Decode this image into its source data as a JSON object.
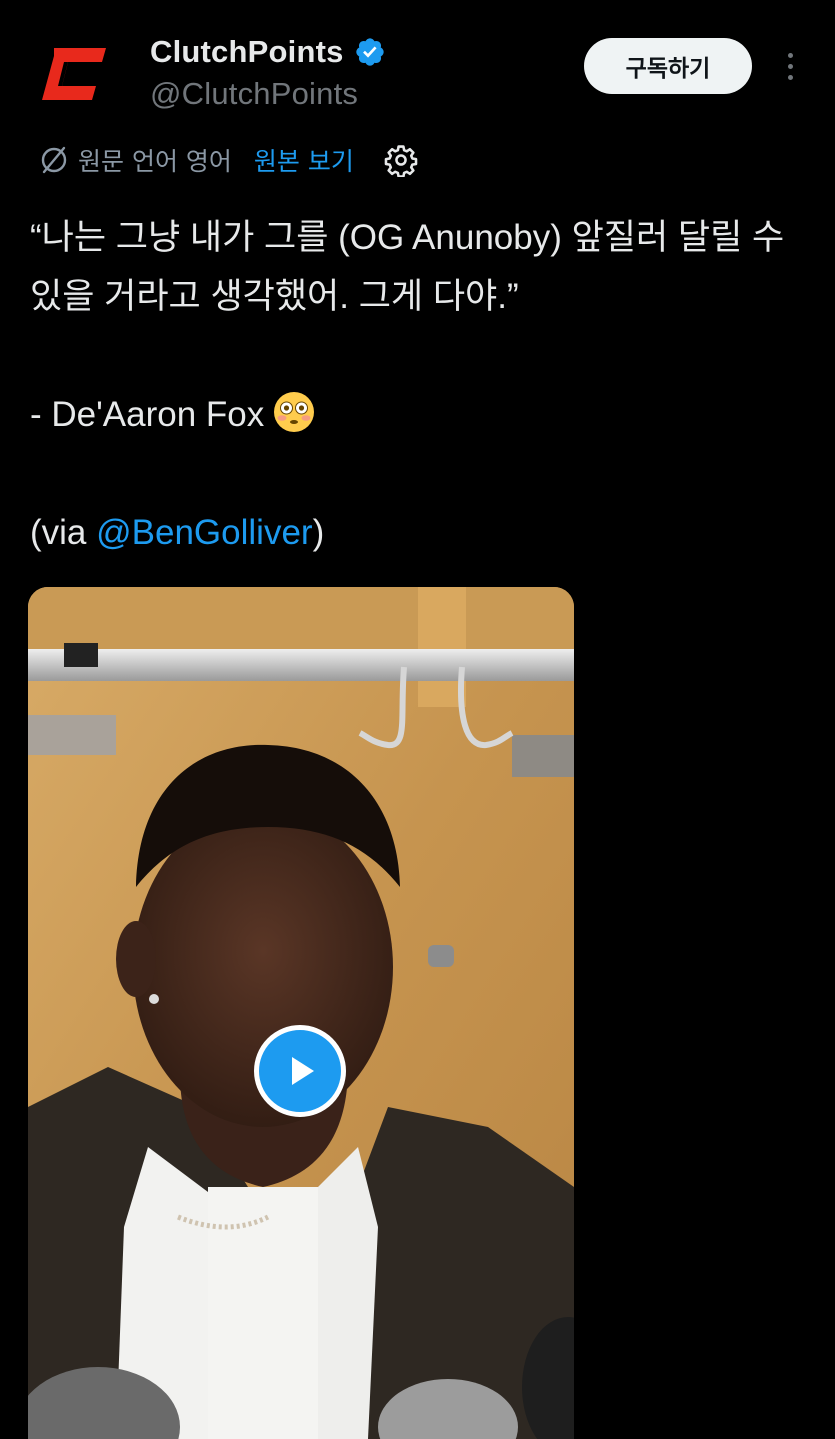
{
  "account": {
    "display_name": "ClutchPoints",
    "handle": "@ClutchPoints",
    "verified": true,
    "avatar_icon": "clutchpoints-logo-icon"
  },
  "actions": {
    "subscribe_label": "구독하기",
    "more_icon": "more-vertical-icon"
  },
  "translation": {
    "icon": "translate-globe-icon",
    "source_language_text": "원문 언어 영어",
    "view_original_label": "원본 보기",
    "settings_icon": "gear-icon"
  },
  "tweet": {
    "quote_line": "“나는 그냥 내가 그를 (OG Anunoby) 앞질러 달릴 수 있을 거라고 생각했어. 그게 다야.”",
    "attribution": "- De'Aaron Fox",
    "attribution_emoji": "flushed-face-emoji",
    "via_prefix": "(via ",
    "via_mention": "@BenGolliver",
    "via_suffix": ")"
  },
  "media": {
    "type": "video",
    "play_icon": "play-icon"
  },
  "colors": {
    "background": "#000000",
    "text_primary": "#e7e9ea",
    "text_secondary": "#71767b",
    "accent_blue": "#1d9bf0",
    "brand_red": "#e8291c"
  }
}
